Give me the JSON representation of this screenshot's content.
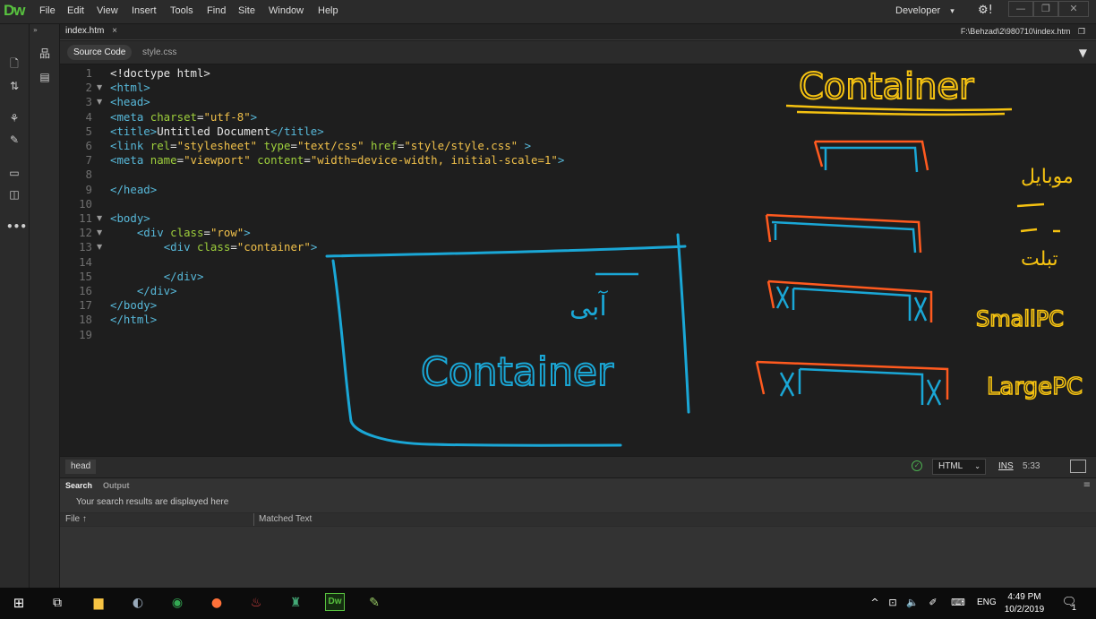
{
  "app": {
    "logo": "Dw",
    "menus": [
      "File",
      "Edit",
      "View",
      "Insert",
      "Tools",
      "Find",
      "Site",
      "Window",
      "Help"
    ],
    "workspace": "Developer",
    "workspace_caret": "▾"
  },
  "document": {
    "tab": "index.htm",
    "path": "F:\\Behzad\\2\\980710\\index.htm",
    "related_files": [
      "Source Code",
      "style.css"
    ]
  },
  "code_lines": [
    {
      "n": "1",
      "fold": "",
      "html": "<span class='p'>&lt;!doctype html&gt;</span>"
    },
    {
      "n": "2",
      "fold": "▼",
      "html": "<span class='t'>&lt;html&gt;</span>"
    },
    {
      "n": "3",
      "fold": "▼",
      "html": "<span class='t'>&lt;head&gt;</span>"
    },
    {
      "n": "4",
      "fold": "",
      "html": "<span class='t'>&lt;meta </span><span class='a'>charset</span><span class='p'>=</span><span class='v'>\"utf-8\"</span><span class='t'>&gt;</span>"
    },
    {
      "n": "5",
      "fold": "",
      "html": "<span class='t'>&lt;title&gt;</span><span class='p'>Untitled Document</span><span class='t'>&lt;/title&gt;</span>"
    },
    {
      "n": "6",
      "fold": "",
      "html": "<span class='t'>&lt;link </span><span class='a'>rel</span><span class='p'>=</span><span class='v'>\"stylesheet\"</span> <span class='a'>type</span><span class='p'>=</span><span class='v'>\"text/css\"</span> <span class='a'>href</span><span class='p'>=</span><span class='v'>\"style/style.css\"</span> <span class='t'>&gt;</span>"
    },
    {
      "n": "7",
      "fold": "",
      "html": "<span class='t'>&lt;meta </span><span class='a'>name</span><span class='p'>=</span><span class='v'>\"viewport\"</span> <span class='a'>content</span><span class='p'>=</span><span class='v'>\"width=device-width, initial-scale=1\"</span><span class='t'>&gt;</span>"
    },
    {
      "n": "8",
      "fold": "",
      "html": ""
    },
    {
      "n": "9",
      "fold": "",
      "html": "<span class='t'>&lt;/head&gt;</span>"
    },
    {
      "n": "10",
      "fold": "",
      "html": ""
    },
    {
      "n": "11",
      "fold": "▼",
      "html": "<span class='t'>&lt;body&gt;</span>"
    },
    {
      "n": "12",
      "fold": "▼",
      "html": "    <span class='t'>&lt;div </span><span class='a'>class</span><span class='p'>=</span><span class='v'>\"row\"</span><span class='t'>&gt;</span>"
    },
    {
      "n": "13",
      "fold": "▼",
      "html": "        <span class='t'>&lt;div </span><span class='a'>class</span><span class='p'>=</span><span class='v'>\"container\"</span><span class='t'>&gt;</span>"
    },
    {
      "n": "14",
      "fold": "",
      "html": ""
    },
    {
      "n": "15",
      "fold": "",
      "html": "        <span class='t'>&lt;/div&gt;</span>"
    },
    {
      "n": "16",
      "fold": "",
      "html": "    <span class='t'>&lt;/div&gt;</span>"
    },
    {
      "n": "17",
      "fold": "",
      "html": "<span class='t'>&lt;/body&gt;</span>"
    },
    {
      "n": "18",
      "fold": "",
      "html": "<span class='t'>&lt;/html&gt;</span>"
    },
    {
      "n": "19",
      "fold": "",
      "html": ""
    }
  ],
  "status": {
    "tag": "head",
    "language": "HTML",
    "mode": "INS",
    "cursor": "5:33"
  },
  "panel": {
    "tabs": [
      "Search",
      "Output"
    ],
    "message": "Your search results are displayed here",
    "col_file": "File ↑",
    "col_matched": "Matched Text"
  },
  "taskbar": {
    "language": "ENG",
    "time": "4:49 PM",
    "date": "10/2/2019",
    "notifications": "1"
  },
  "annotations": {
    "title": "Container",
    "box_label": "Container",
    "arabic_label": "آبی",
    "small_pc": "SmallPC",
    "large_pc": "LargePC",
    "mobile": "موبایل",
    "tablet": "تبلت"
  },
  "colors": {
    "editor_bg": "#1e1e1e",
    "tag": "#57b8d9",
    "attr": "#9ecf3c",
    "value": "#f0c04a",
    "ink_yellow": "#f5c211",
    "ink_blue": "#1aa7d6",
    "ink_orange": "#ff5a1f"
  }
}
